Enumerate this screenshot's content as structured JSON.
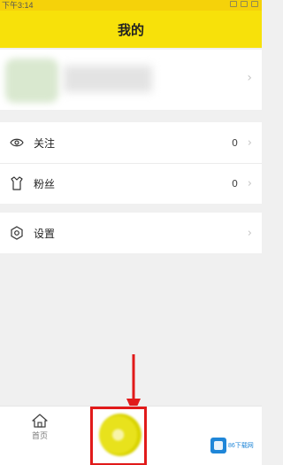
{
  "status_bar": {
    "time": "下午3:14"
  },
  "header": {
    "title": "我的"
  },
  "profile": {
    "chevron": "›"
  },
  "menu_group1": {
    "items": [
      {
        "label": "关注",
        "count": "0",
        "icon": "eye-icon"
      },
      {
        "label": "粉丝",
        "count": "0",
        "icon": "shirt-icon"
      }
    ]
  },
  "menu_group2": {
    "items": [
      {
        "label": "设置",
        "icon": "gear-icon"
      }
    ]
  },
  "tabbar": {
    "home_label": "首页",
    "center_icon": "create-button-icon"
  },
  "watermark": {
    "text": "86下载网"
  },
  "colors": {
    "header_bg": "#f7e10a",
    "annotation": "#e11a1a"
  }
}
